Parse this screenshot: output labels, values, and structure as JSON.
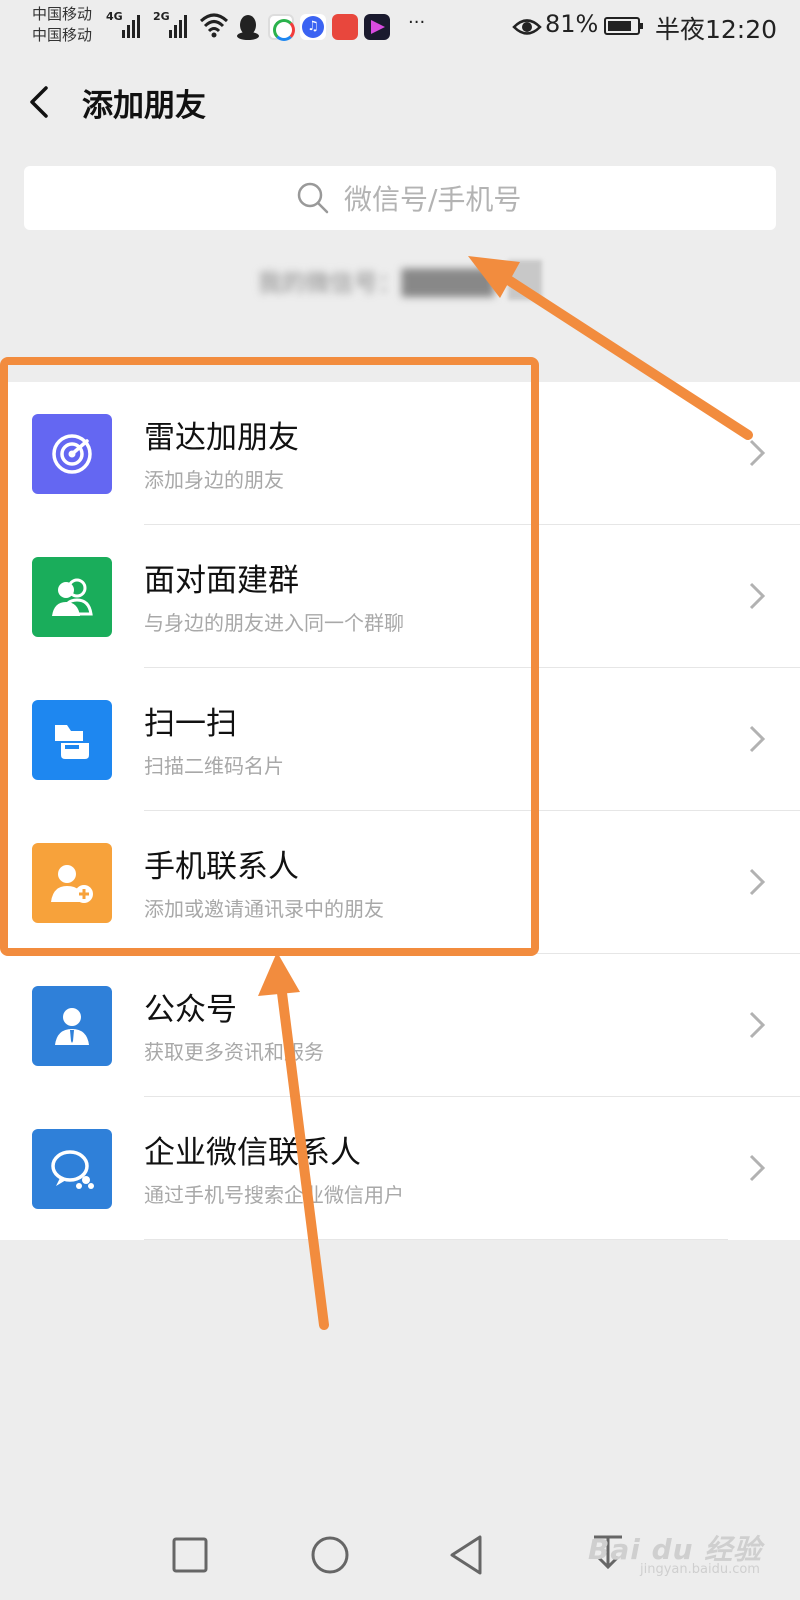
{
  "status_bar": {
    "carrier_1": "中国移动",
    "carrier_2": "中国移动",
    "net_1": "4G",
    "net_2": "2G",
    "more": "···",
    "battery": "81%",
    "battery_level": 0.81,
    "time": "半夜12:20"
  },
  "header": {
    "title": "添加朋友",
    "back_icon": "chevron-left-icon"
  },
  "search": {
    "placeholder": "微信号/手机号",
    "value": ""
  },
  "my_id": {
    "text": "我的微信号：█████"
  },
  "list": {
    "items": [
      {
        "label": "雷达加朋友",
        "sub": "添加身边的朋友",
        "icon": "radar-icon",
        "color": "#6467f2"
      },
      {
        "label": "面对面建群",
        "sub": "与身边的朋友进入同一个群聊",
        "icon": "group-icon",
        "color": "#1aad5b"
      },
      {
        "label": "扫一扫",
        "sub": "扫描二维码名片",
        "icon": "scan-icon",
        "color": "#1e87f0"
      },
      {
        "label": "手机联系人",
        "sub": "添加或邀请通讯录中的朋友",
        "icon": "phone-contact-icon",
        "color": "#f7a23b"
      },
      {
        "label": "公众号",
        "sub": "获取更多资讯和服务",
        "icon": "official-account-icon",
        "color": "#2f80d9"
      },
      {
        "label": "企业微信联系人",
        "sub": "通过手机号搜索企业微信用户",
        "icon": "work-wechat-icon",
        "color": "#2f80d9"
      }
    ]
  },
  "annotation": {
    "color": "#f28c3e"
  },
  "watermark": {
    "text": "Bai du 经验",
    "sub": "jingyan.baidu.com"
  }
}
